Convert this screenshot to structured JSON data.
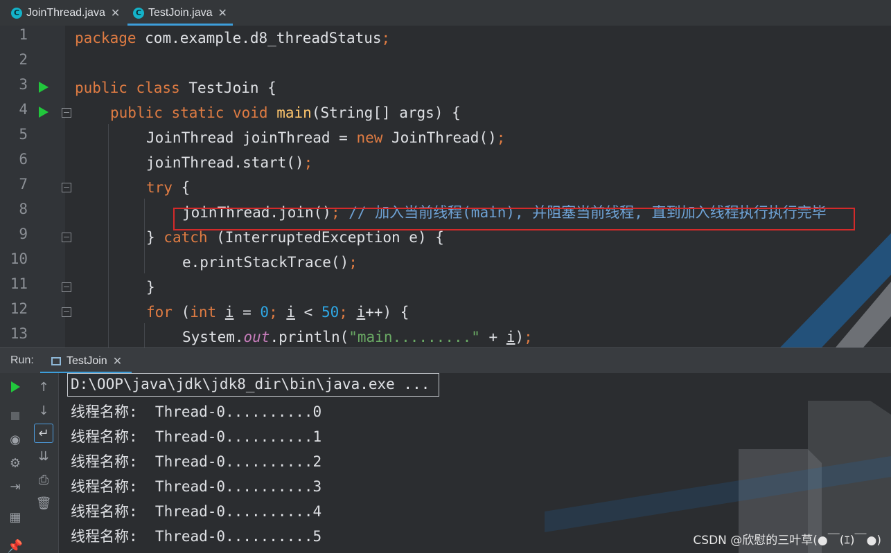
{
  "tabs": [
    {
      "icon": "C",
      "label": "JoinThread.java",
      "close": "✕"
    },
    {
      "icon": "C",
      "label": "TestJoin.java",
      "close": "✕"
    }
  ],
  "line_numbers": [
    "1",
    "2",
    "3",
    "4",
    "5",
    "6",
    "7",
    "8",
    "9",
    "10",
    "11",
    "12",
    "13"
  ],
  "code": {
    "l1_kw": "package",
    "l1_rest": " com.example.d8_threadStatus",
    "l1_semi": ";",
    "l3_kw": "public class",
    "l3_rest": " TestJoin {",
    "l4_kw": "public static void",
    "l4_fn": "main",
    "l4_rest": "(String[] args) {",
    "l5_a": "JoinThread joinThread = ",
    "l5_kw": "new",
    "l5_b": " JoinThread()",
    "l5_semi": ";",
    "l6_a": "joinThread.start()",
    "l6_semi": ";",
    "l7_kw": "try",
    "l7_rest": " {",
    "l8_a": "joinThread.join()",
    "l8_semi": ";",
    "l8_cmt": " // 加入当前线程(main), 并阻塞当前线程, 直到加入线程执行执行完毕",
    "l9_a": "} ",
    "l9_kw": "catch",
    "l9_rest": " (InterruptedException e) {",
    "l10_a": "e.printStackTrace()",
    "l10_semi": ";",
    "l11_a": "}",
    "l12_kw": "for",
    "l12_a": " (",
    "l12_kw2": "int",
    "l12_sp": " ",
    "l12_i1": "i",
    "l12_eq": " = ",
    "l12_n0": "0",
    "l12_s1": "; ",
    "l12_i2": "i",
    "l12_lt": " < ",
    "l12_n50": "50",
    "l12_s2": "; ",
    "l12_i3": "i",
    "l12_end": "++) {",
    "l13_a": "System.",
    "l13_field": "out",
    "l13_b": ".println(",
    "l13_str": "\"main.........\"",
    "l13_c": " + ",
    "l13_i": "i",
    "l13_d": ")",
    "l13_semi": ";"
  },
  "run": {
    "label": "Run:",
    "tab_label": "TestJoin",
    "tab_close": "✕"
  },
  "console": {
    "command": "D:\\OOP\\java\\jdk\\jdk8_dir\\bin\\java.exe ...",
    "lines": [
      "线程名称:  Thread-0..........0",
      "线程名称:  Thread-0..........1",
      "线程名称:  Thread-0..........2",
      "线程名称:  Thread-0..........3",
      "线程名称:  Thread-0..........4",
      "线程名称:  Thread-0..........5"
    ]
  },
  "watermark": "CSDN @欣慰的三叶草(●￣(ｴ)￣●)",
  "colors": {
    "accent": "#3d9edb",
    "run_green": "#21c73c",
    "highlight_border": "#d42a2a"
  }
}
